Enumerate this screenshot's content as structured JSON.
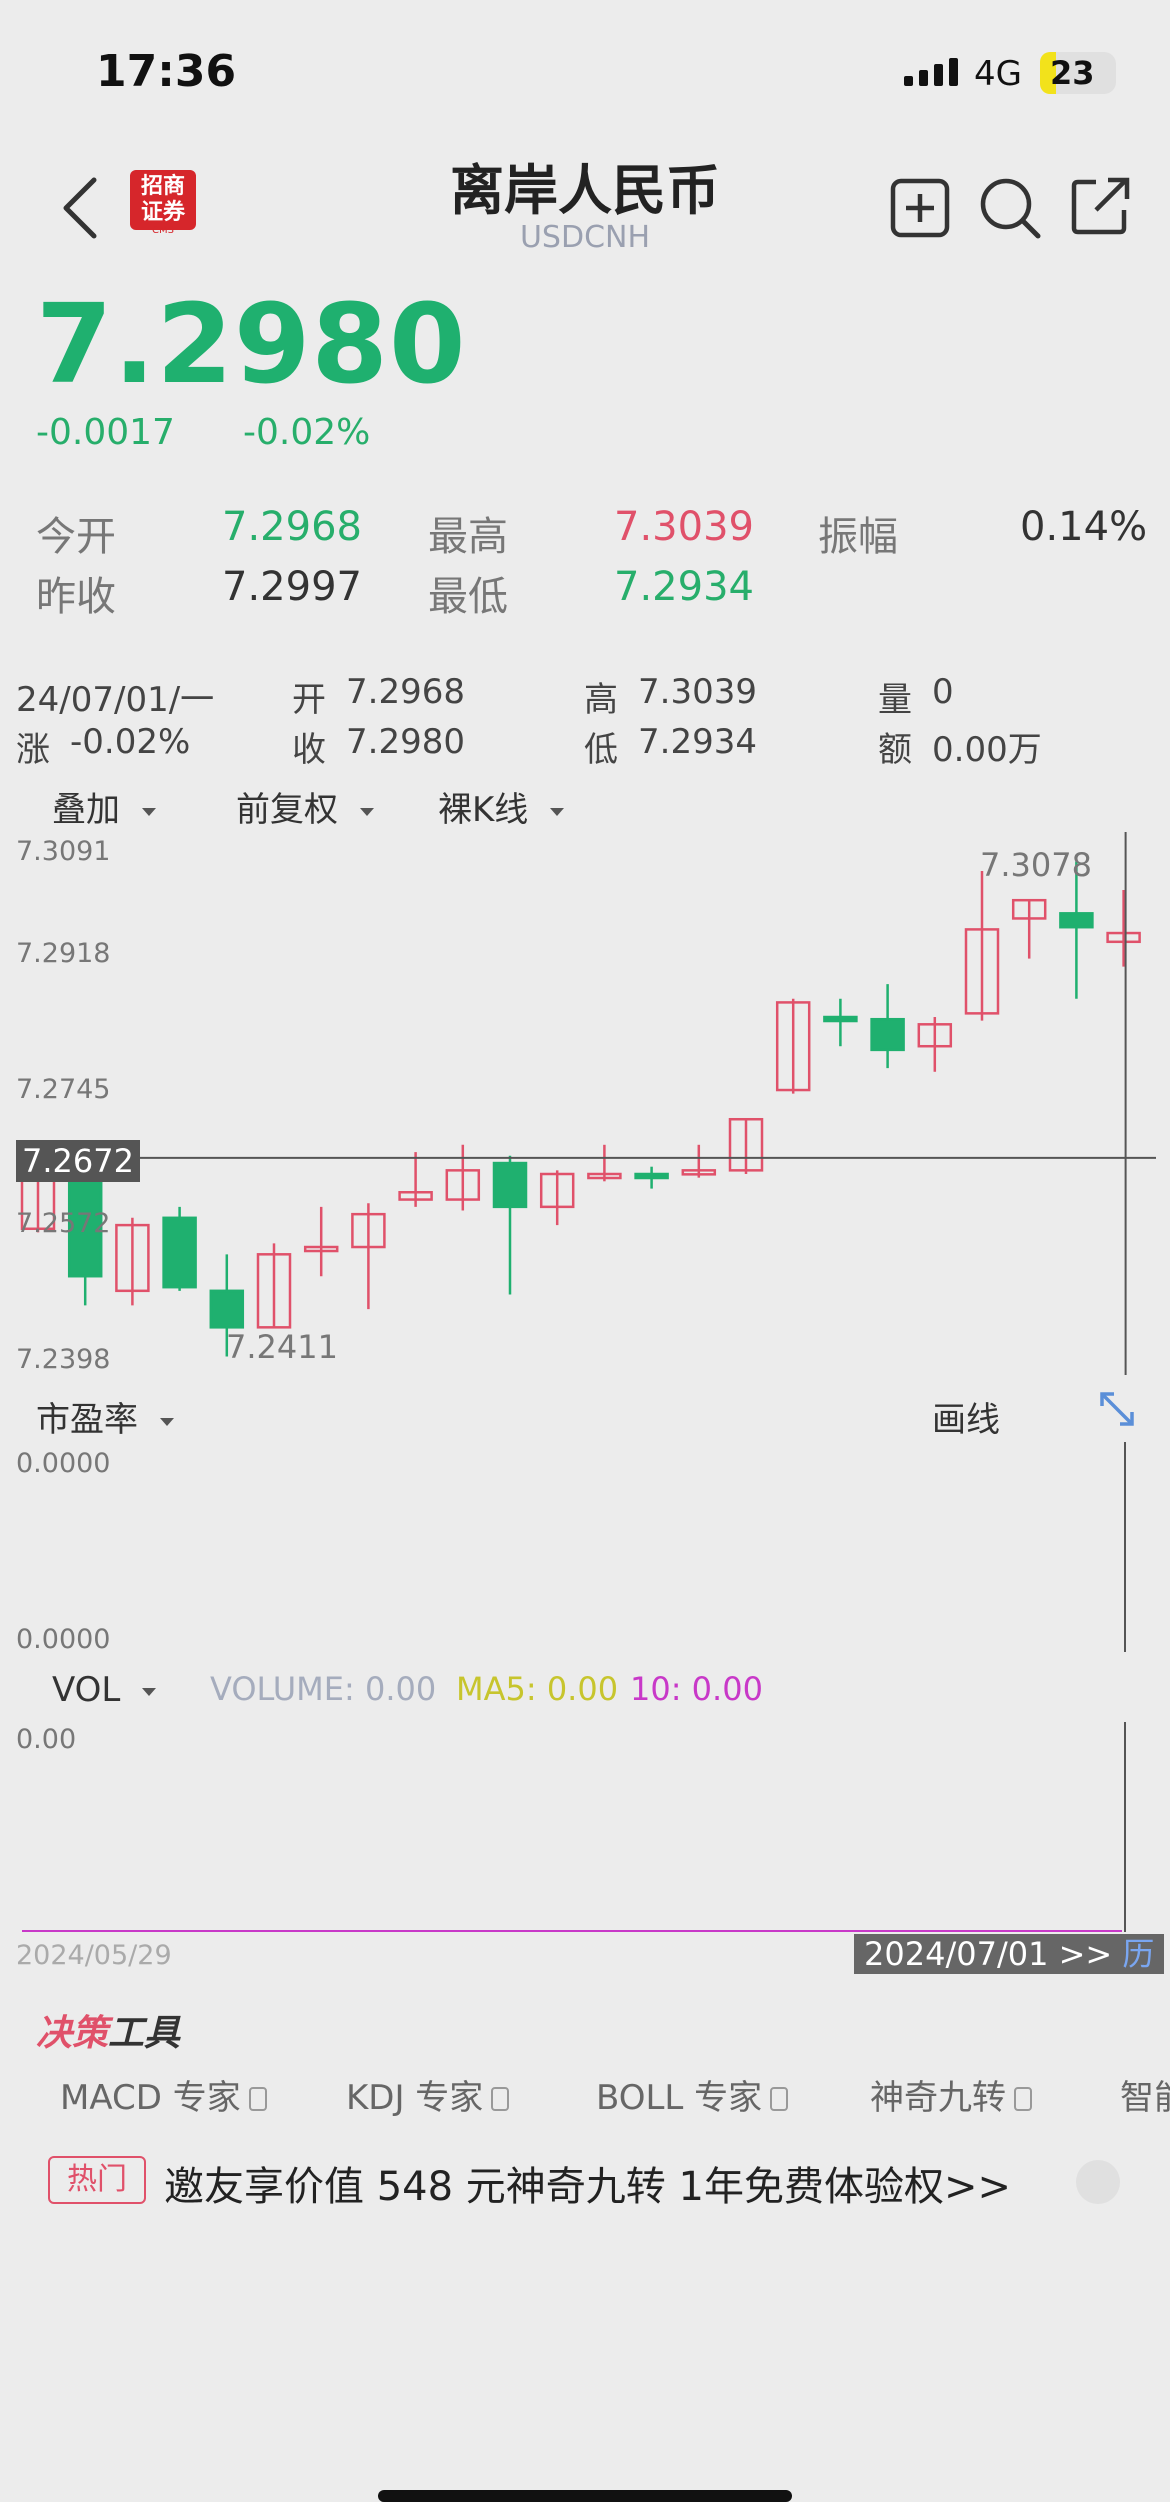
{
  "status": {
    "time": "17:36",
    "carrier": "4G",
    "battery": "23"
  },
  "header": {
    "title": "离岸人民币",
    "subtitle": "USDCNH",
    "logo_line1": "招商",
    "logo_line2": "证券",
    "logo_sub": "CMS"
  },
  "quote": {
    "price": "7.2980",
    "change": "-0.0017",
    "change_pct": "-0.02%"
  },
  "stats": {
    "open_label": "今开",
    "open": "7.2968",
    "high_label": "最高",
    "high": "7.3039",
    "amp_label": "振幅",
    "amp": "0.14%",
    "prev_label": "昨收",
    "prev": "7.2997",
    "low_label": "最低",
    "low": "7.2934"
  },
  "bar_info": {
    "date": "24/07/01/一",
    "open_label": "开",
    "open": "7.2968",
    "high_label": "高",
    "high": "7.3039",
    "vol_label": "量",
    "vol": "0",
    "chg_label": "涨",
    "chg": "-0.02%",
    "close_label": "收",
    "close": "7.2980",
    "low_label": "低",
    "low": "7.2934",
    "amt_label": "额",
    "amt": "0.00万"
  },
  "toolbar": {
    "overlay": "叠加",
    "adjust": "前复权",
    "kline": "裸K线"
  },
  "axis": {
    "y1": "7.3091",
    "y2": "7.2918",
    "y3": "7.2745",
    "y4": "7.2572",
    "y5": "7.2398",
    "crosshair": "7.2672",
    "max_label": "7.3078",
    "min_label": "7.2411"
  },
  "pe": {
    "label": "市盈率",
    "draw": "画线",
    "top": "0.0000",
    "bottom": "0.0000"
  },
  "vol": {
    "label": "VOL",
    "volume": "VOLUME: 0.00",
    "ma5": "MA5: 0.00",
    "ma10": "10: 0.00",
    "zero": "0.00",
    "start_date": "2024/05/29",
    "end_date": "2024/07/01 >>",
    "hist": "历"
  },
  "tools": {
    "title_a": "决策",
    "title_b": "工具",
    "items": [
      "MACD 专家",
      "KDJ 专家",
      "BOLL 专家",
      "神奇九转",
      "智能"
    ]
  },
  "promo": {
    "tag": "热门",
    "text": "邀友享价值 548 元神奇九转 1年免费体验权>>"
  },
  "colors": {
    "up": "#e0516a",
    "down": "#1fb06f"
  },
  "chart_data": {
    "type": "candlestick",
    "candles": [
      {
        "o": 7.2575,
        "c": 7.2645,
        "h": 7.266,
        "l": 7.257
      },
      {
        "o": 7.2645,
        "c": 7.251,
        "h": 7.265,
        "l": 7.247
      },
      {
        "o": 7.249,
        "c": 7.258,
        "h": 7.259,
        "l": 7.247
      },
      {
        "o": 7.259,
        "c": 7.2495,
        "h": 7.2605,
        "l": 7.249
      },
      {
        "o": 7.249,
        "c": 7.244,
        "h": 7.254,
        "l": 7.24
      },
      {
        "o": 7.244,
        "c": 7.254,
        "h": 7.2555,
        "l": 7.244
      },
      {
        "o": 7.2545,
        "c": 7.255,
        "h": 7.2605,
        "l": 7.251
      },
      {
        "o": 7.255,
        "c": 7.2595,
        "h": 7.261,
        "l": 7.2465
      },
      {
        "o": 7.2615,
        "c": 7.2625,
        "h": 7.268,
        "l": 7.2605
      },
      {
        "o": 7.2615,
        "c": 7.2655,
        "h": 7.269,
        "l": 7.26
      },
      {
        "o": 7.2665,
        "c": 7.2605,
        "h": 7.2675,
        "l": 7.2485
      },
      {
        "o": 7.2605,
        "c": 7.265,
        "h": 7.2655,
        "l": 7.258
      },
      {
        "o": 7.2645,
        "c": 7.265,
        "h": 7.269,
        "l": 7.264
      },
      {
        "o": 7.265,
        "c": 7.2645,
        "h": 7.266,
        "l": 7.263
      },
      {
        "o": 7.265,
        "c": 7.2655,
        "h": 7.269,
        "l": 7.2645
      },
      {
        "o": 7.2655,
        "c": 7.2725,
        "h": 7.2725,
        "l": 7.265
      },
      {
        "o": 7.2765,
        "c": 7.2885,
        "h": 7.289,
        "l": 7.276
      },
      {
        "o": 7.2865,
        "c": 7.2862,
        "h": 7.289,
        "l": 7.2825
      },
      {
        "o": 7.2862,
        "c": 7.282,
        "h": 7.291,
        "l": 7.2795
      },
      {
        "o": 7.2825,
        "c": 7.2855,
        "h": 7.2865,
        "l": 7.279
      },
      {
        "o": 7.287,
        "c": 7.2985,
        "h": 7.3065,
        "l": 7.286
      },
      {
        "o": 7.3,
        "c": 7.3025,
        "h": 7.3025,
        "l": 7.2945
      },
      {
        "o": 7.3007,
        "c": 7.2988,
        "h": 7.3078,
        "l": 7.289
      },
      {
        "o": 7.2968,
        "c": 7.298,
        "h": 7.3039,
        "l": 7.2934
      }
    ],
    "ylim": [
      7.2398,
      7.3091
    ],
    "crosshair_value": 7.2672
  }
}
